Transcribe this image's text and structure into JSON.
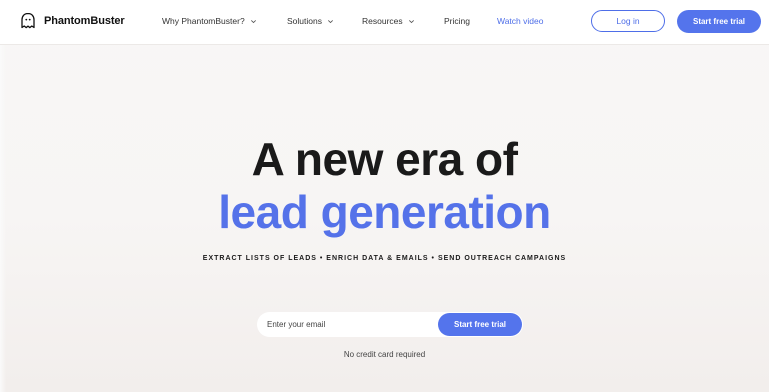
{
  "nav": {
    "brand": "PhantomBuster",
    "items": [
      {
        "label": "Why PhantomBuster?",
        "has_dropdown": true
      },
      {
        "label": "Solutions",
        "has_dropdown": true
      },
      {
        "label": "Resources",
        "has_dropdown": true
      },
      {
        "label": "Pricing",
        "has_dropdown": false
      },
      {
        "label": "Watch video",
        "has_dropdown": false
      }
    ],
    "login_label": "Log in",
    "trial_label": "Start free trial"
  },
  "hero": {
    "title_line1": "A new era of",
    "title_line2": "lead generation",
    "tagline": "EXTRACT LISTS OF LEADS • ENRICH DATA & EMAILS • SEND OUTREACH CAMPAIGNS",
    "email_placeholder": "Enter your email",
    "cta_label": "Start free trial",
    "note": "No credit card required"
  },
  "colors": {
    "accent": "#5474ec",
    "headline_dark": "#1a1a1a",
    "headline_accent": "#5572e9",
    "background": "#f7f5f4"
  },
  "icons": {
    "logo": "phantom-ghost-icon",
    "dropdown": "chevron-down-icon"
  }
}
